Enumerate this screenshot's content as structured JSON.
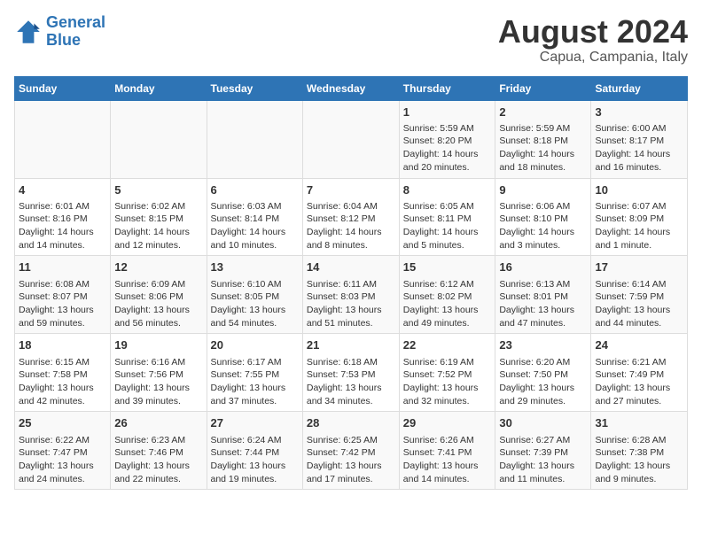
{
  "header": {
    "logo_line1": "General",
    "logo_line2": "Blue",
    "title": "August 2024",
    "subtitle": "Capua, Campania, Italy"
  },
  "weekdays": [
    "Sunday",
    "Monday",
    "Tuesday",
    "Wednesday",
    "Thursday",
    "Friday",
    "Saturday"
  ],
  "weeks": [
    [
      {
        "day": "",
        "content": ""
      },
      {
        "day": "",
        "content": ""
      },
      {
        "day": "",
        "content": ""
      },
      {
        "day": "",
        "content": ""
      },
      {
        "day": "1",
        "content": "Sunrise: 5:59 AM\nSunset: 8:20 PM\nDaylight: 14 hours\nand 20 minutes."
      },
      {
        "day": "2",
        "content": "Sunrise: 5:59 AM\nSunset: 8:18 PM\nDaylight: 14 hours\nand 18 minutes."
      },
      {
        "day": "3",
        "content": "Sunrise: 6:00 AM\nSunset: 8:17 PM\nDaylight: 14 hours\nand 16 minutes."
      }
    ],
    [
      {
        "day": "4",
        "content": "Sunrise: 6:01 AM\nSunset: 8:16 PM\nDaylight: 14 hours\nand 14 minutes."
      },
      {
        "day": "5",
        "content": "Sunrise: 6:02 AM\nSunset: 8:15 PM\nDaylight: 14 hours\nand 12 minutes."
      },
      {
        "day": "6",
        "content": "Sunrise: 6:03 AM\nSunset: 8:14 PM\nDaylight: 14 hours\nand 10 minutes."
      },
      {
        "day": "7",
        "content": "Sunrise: 6:04 AM\nSunset: 8:12 PM\nDaylight: 14 hours\nand 8 minutes."
      },
      {
        "day": "8",
        "content": "Sunrise: 6:05 AM\nSunset: 8:11 PM\nDaylight: 14 hours\nand 5 minutes."
      },
      {
        "day": "9",
        "content": "Sunrise: 6:06 AM\nSunset: 8:10 PM\nDaylight: 14 hours\nand 3 minutes."
      },
      {
        "day": "10",
        "content": "Sunrise: 6:07 AM\nSunset: 8:09 PM\nDaylight: 14 hours\nand 1 minute."
      }
    ],
    [
      {
        "day": "11",
        "content": "Sunrise: 6:08 AM\nSunset: 8:07 PM\nDaylight: 13 hours\nand 59 minutes."
      },
      {
        "day": "12",
        "content": "Sunrise: 6:09 AM\nSunset: 8:06 PM\nDaylight: 13 hours\nand 56 minutes."
      },
      {
        "day": "13",
        "content": "Sunrise: 6:10 AM\nSunset: 8:05 PM\nDaylight: 13 hours\nand 54 minutes."
      },
      {
        "day": "14",
        "content": "Sunrise: 6:11 AM\nSunset: 8:03 PM\nDaylight: 13 hours\nand 51 minutes."
      },
      {
        "day": "15",
        "content": "Sunrise: 6:12 AM\nSunset: 8:02 PM\nDaylight: 13 hours\nand 49 minutes."
      },
      {
        "day": "16",
        "content": "Sunrise: 6:13 AM\nSunset: 8:01 PM\nDaylight: 13 hours\nand 47 minutes."
      },
      {
        "day": "17",
        "content": "Sunrise: 6:14 AM\nSunset: 7:59 PM\nDaylight: 13 hours\nand 44 minutes."
      }
    ],
    [
      {
        "day": "18",
        "content": "Sunrise: 6:15 AM\nSunset: 7:58 PM\nDaylight: 13 hours\nand 42 minutes."
      },
      {
        "day": "19",
        "content": "Sunrise: 6:16 AM\nSunset: 7:56 PM\nDaylight: 13 hours\nand 39 minutes."
      },
      {
        "day": "20",
        "content": "Sunrise: 6:17 AM\nSunset: 7:55 PM\nDaylight: 13 hours\nand 37 minutes."
      },
      {
        "day": "21",
        "content": "Sunrise: 6:18 AM\nSunset: 7:53 PM\nDaylight: 13 hours\nand 34 minutes."
      },
      {
        "day": "22",
        "content": "Sunrise: 6:19 AM\nSunset: 7:52 PM\nDaylight: 13 hours\nand 32 minutes."
      },
      {
        "day": "23",
        "content": "Sunrise: 6:20 AM\nSunset: 7:50 PM\nDaylight: 13 hours\nand 29 minutes."
      },
      {
        "day": "24",
        "content": "Sunrise: 6:21 AM\nSunset: 7:49 PM\nDaylight: 13 hours\nand 27 minutes."
      }
    ],
    [
      {
        "day": "25",
        "content": "Sunrise: 6:22 AM\nSunset: 7:47 PM\nDaylight: 13 hours\nand 24 minutes."
      },
      {
        "day": "26",
        "content": "Sunrise: 6:23 AM\nSunset: 7:46 PM\nDaylight: 13 hours\nand 22 minutes."
      },
      {
        "day": "27",
        "content": "Sunrise: 6:24 AM\nSunset: 7:44 PM\nDaylight: 13 hours\nand 19 minutes."
      },
      {
        "day": "28",
        "content": "Sunrise: 6:25 AM\nSunset: 7:42 PM\nDaylight: 13 hours\nand 17 minutes."
      },
      {
        "day": "29",
        "content": "Sunrise: 6:26 AM\nSunset: 7:41 PM\nDaylight: 13 hours\nand 14 minutes."
      },
      {
        "day": "30",
        "content": "Sunrise: 6:27 AM\nSunset: 7:39 PM\nDaylight: 13 hours\nand 11 minutes."
      },
      {
        "day": "31",
        "content": "Sunrise: 6:28 AM\nSunset: 7:38 PM\nDaylight: 13 hours\nand 9 minutes."
      }
    ]
  ]
}
